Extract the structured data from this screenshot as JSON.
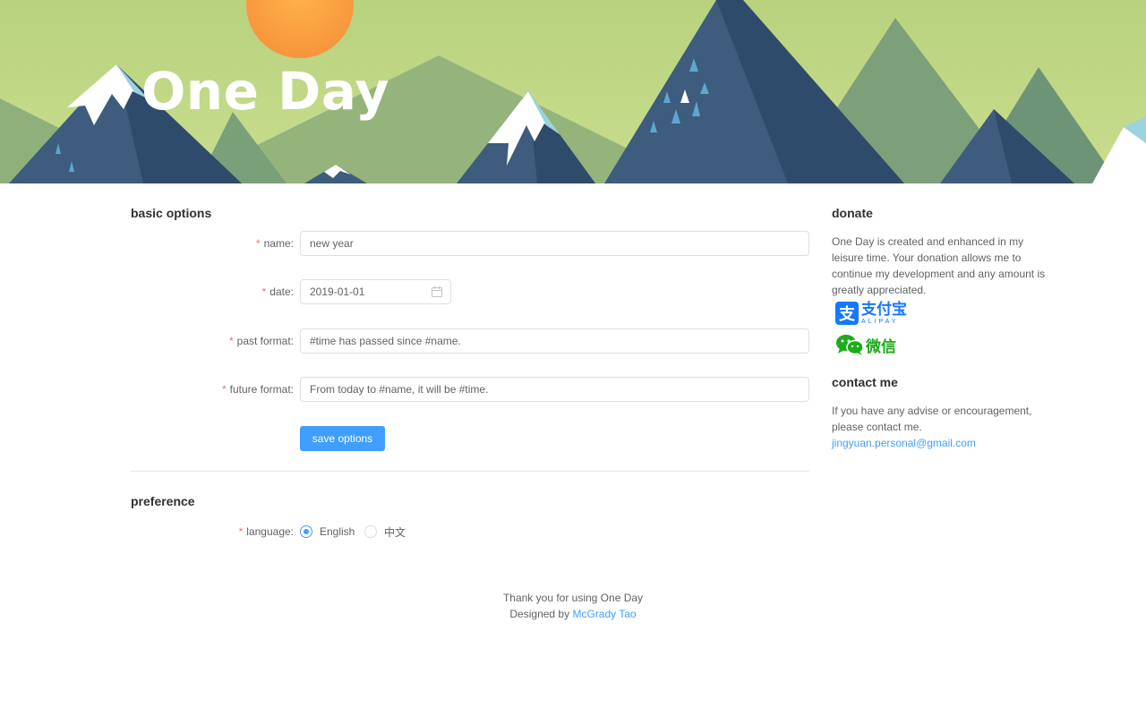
{
  "header": {
    "title": "One Day"
  },
  "basic_options": {
    "title": "basic options",
    "fields": {
      "name": {
        "label": "name:",
        "value": "new year"
      },
      "date": {
        "label": "date:",
        "value": "2019-01-01"
      },
      "past_format": {
        "label": "past format:",
        "value": "#time has passed since #name."
      },
      "future_format": {
        "label": "future format:",
        "value": "From today to #name, it will be #time."
      }
    },
    "required_mark": "*",
    "save_label": "save options"
  },
  "preference": {
    "title": "preference",
    "language_label": "language:",
    "options": [
      {
        "label": "English",
        "selected": true
      },
      {
        "label": "中文",
        "selected": false
      }
    ]
  },
  "donate": {
    "title": "donate",
    "text": "One Day is created and enhanced in my leisure time. Your donation allows me to continue my development and any amount is greatly appreciated.",
    "alipay": {
      "icon": "alipay-icon",
      "label": "支付宝",
      "sublabel": "ALIPAY",
      "color": "#1677ff"
    },
    "wechat": {
      "icon": "wechat-icon",
      "label": "微信",
      "color": "#1aad19"
    }
  },
  "contact": {
    "title": "contact me",
    "text": "If you have any advise or encouragement, please contact me.",
    "email": "jingyuan.personal@gmail.com"
  },
  "footer": {
    "thanks": "Thank you for using One Day",
    "designed_by": "Designed by",
    "author": "McGrady Tao"
  },
  "colors": {
    "primary": "#409eff",
    "required": "#f56c6c"
  }
}
